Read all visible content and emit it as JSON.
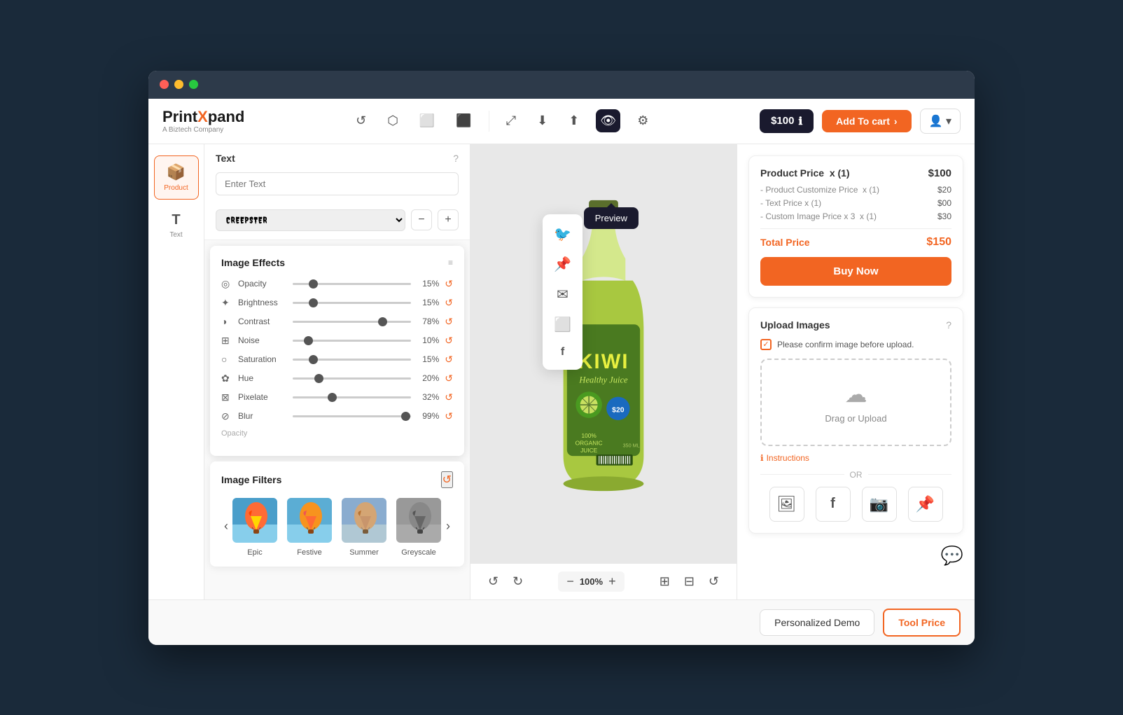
{
  "browser": {
    "dots": [
      "red",
      "yellow",
      "green"
    ]
  },
  "navbar": {
    "logo": "PrintXpand",
    "logo_x": "X",
    "logo_subtitle": "A Biztech Company",
    "price_badge": "$100",
    "price_info_icon": "ℹ",
    "add_to_cart": "Add To cart",
    "icons": [
      "↺",
      "⬡",
      "⬜",
      "⬛"
    ]
  },
  "sidebar": {
    "tools": [
      {
        "icon": "📦",
        "label": "Product",
        "active": true
      },
      {
        "icon": "T",
        "label": "Text",
        "active": false
      }
    ]
  },
  "text_panel": {
    "title": "Text",
    "placeholder": "Enter Text",
    "font": "CREEPSTER",
    "font_size_minus": "−",
    "font_size_plus": "+"
  },
  "image_effects": {
    "title": "Image Effects",
    "effects": [
      {
        "icon": "◎",
        "label": "Opacity",
        "value": "15%",
        "percent": 15
      },
      {
        "icon": "✦",
        "label": "Brightness",
        "value": "15%",
        "percent": 15
      },
      {
        "icon": "◑",
        "label": "Contrast",
        "value": "78%",
        "percent": 78
      },
      {
        "icon": "⊞",
        "label": "Noise",
        "value": "10%",
        "percent": 10
      },
      {
        "icon": "○",
        "label": "Saturation",
        "value": "15%",
        "percent": 15
      },
      {
        "icon": "✿",
        "label": "Hue",
        "value": "20%",
        "percent": 20
      },
      {
        "icon": "⊠",
        "label": "Pixelate",
        "value": "32%",
        "percent": 32
      },
      {
        "icon": "⊘",
        "label": "Blur",
        "value": "99%",
        "percent": 99
      }
    ]
  },
  "image_filters": {
    "title": "Image Filters",
    "filters": [
      {
        "name": "Epic",
        "color": "#ff7f50",
        "active": false
      },
      {
        "name": "Festive",
        "color": "#ff9f40",
        "active": false
      },
      {
        "name": "Summer",
        "color": "#c8a882",
        "active": false
      },
      {
        "name": "Greyscale",
        "color": "#888888",
        "active": false
      }
    ]
  },
  "preview_tooltip": "Preview",
  "social_share": {
    "icons": [
      "🐦",
      "📌",
      "✉",
      "⬜",
      "f"
    ]
  },
  "canvas": {
    "zoom_value": "100%",
    "zoom_minus": "−",
    "zoom_plus": "+",
    "undo": "↺",
    "redo": "↻",
    "refresh": "↺"
  },
  "product_image": {
    "alt": "Kiwi Healthy Juice bottle",
    "brand": "KIWI",
    "subtitle": "Healthy Juice",
    "badge": "$20",
    "description1": "100%",
    "description2": "ORGANIC",
    "description3": "JUICE"
  },
  "pricing": {
    "title": "Product Price",
    "quantity": "x (1)",
    "main_price": "$100",
    "items": [
      {
        "label": "- Product Customize Price",
        "qty": "x (1)",
        "amount": "$20"
      },
      {
        "label": "- Text Price",
        "qty": "x (1)",
        "amount": "$00"
      },
      {
        "label": "- Custom Image Price x 3",
        "qty": "x (1)",
        "amount": "$30"
      }
    ],
    "total_label": "Total Price",
    "total_amount": "$150",
    "buy_now": "Buy Now"
  },
  "upload": {
    "title": "Upload Images",
    "confirm_text": "Please confirm image before upload.",
    "drag_text": "Drag or Upload",
    "instructions_label": "Instructions",
    "or_label": "OR",
    "social_buttons": [
      "🖼",
      "f",
      "📷",
      "📌"
    ]
  },
  "bottom_bar": {
    "demo_label": "Personalized Demo",
    "tool_price_label": "Tool Price"
  }
}
